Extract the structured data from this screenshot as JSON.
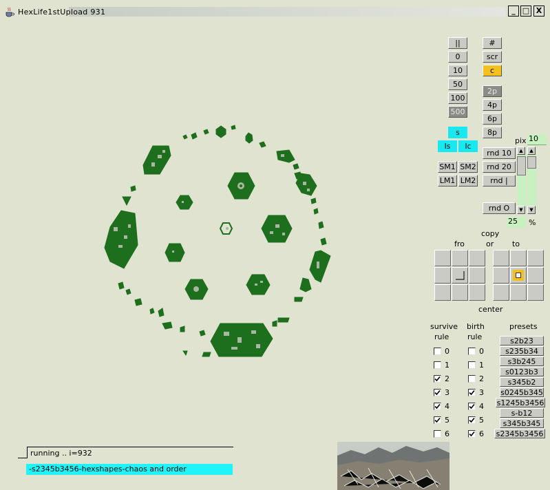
{
  "window": {
    "title": "HexLife1stUpload 931",
    "minimize": "_",
    "maximize": "□",
    "close": "X"
  },
  "speed_buttons": [
    "||",
    "0",
    "10",
    "50",
    "100",
    "500"
  ],
  "view_buttons": [
    "#",
    "scr",
    "c"
  ],
  "period_buttons": [
    "2p",
    "4p",
    "6p",
    "8p"
  ],
  "s_buttons": {
    "s": "s",
    "ls": "ls",
    "lc": "lc"
  },
  "memory_buttons": [
    "SM1",
    "SM2",
    "LM1",
    "LM2"
  ],
  "random_buttons": [
    "rnd 10",
    "rnd 20",
    "rnd |",
    "rnd O"
  ],
  "pix": {
    "label": "pix",
    "value": "10"
  },
  "percent": {
    "value": "25",
    "unit": "%"
  },
  "copy": {
    "copy": "copy",
    "or": "or",
    "fro": "fro",
    "to": "to",
    "center": "center"
  },
  "rules": {
    "survive_label_1": "survive",
    "survive_label_2": "rule",
    "birth_label_1": "birth",
    "birth_label_2": "rule",
    "numbers": [
      "0",
      "1",
      "2",
      "3",
      "4",
      "5",
      "6"
    ],
    "survive_checked": [
      false,
      false,
      true,
      true,
      true,
      true,
      false
    ],
    "birth_checked": [
      false,
      false,
      false,
      true,
      true,
      true,
      true
    ]
  },
  "presets": {
    "label": "presets",
    "items": [
      "s2b23",
      "s235b34",
      "s3b245",
      "s0123b3",
      "s345b2",
      "s0245b345",
      "s1245b3456",
      "s-b12",
      "s345b345",
      "s2345b3456"
    ]
  },
  "status": {
    "text": "running .. i=932",
    "rule_text": "-s2345b3456-hexshapes-chaos and order"
  },
  "colors": {
    "cell_green": "#1d6e1d",
    "accent_cyan": "#1ff4f8",
    "accent_yellow": "#f3c01e"
  }
}
